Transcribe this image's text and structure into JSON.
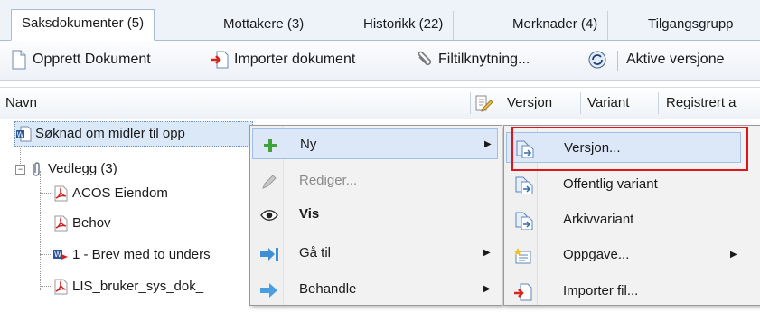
{
  "tabs": [
    {
      "label": "Saksdokumenter (5)",
      "active": true
    },
    {
      "label": "Mottakere (3)"
    },
    {
      "label": "Historikk (22)"
    },
    {
      "label": "Merknader (4)"
    },
    {
      "label": "Tilgangsgrupp"
    }
  ],
  "toolbar": {
    "create_label": "Opprett Dokument",
    "import_label": "Importer dokument",
    "link_label": "Filtilknytning...",
    "active_label": "Aktive versjone"
  },
  "columns": {
    "name": "Navn",
    "version": "Versjon",
    "variant": "Variant",
    "registered": "Registrert a"
  },
  "tree": {
    "main_doc": "Søknad om midler til opp",
    "attachments": "Vedlegg (3)",
    "items": [
      "ACOS Eiendom",
      "Behov",
      "1 - Brev med to unders",
      "LIS_bruker_sys_dok_"
    ]
  },
  "context_menu": {
    "items": [
      {
        "label": "Ny",
        "submenu": true,
        "highlighted": true,
        "icon": "plus-icon"
      },
      {
        "label": "Rediger...",
        "disabled": true,
        "icon": "pencil-icon"
      },
      {
        "label": "Vis",
        "bold": true,
        "icon": "eye-icon"
      },
      {
        "label": "Gå til",
        "submenu": true,
        "icon": "arrow-right-icon"
      },
      {
        "label": "Behandle",
        "submenu": true,
        "icon": "arrow-process-icon"
      }
    ]
  },
  "submenu": {
    "items": [
      {
        "label": "Versjon...",
        "highlighted": true,
        "icon": "document-version-icon"
      },
      {
        "label": "Offentlig variant",
        "icon": "document-variant-icon"
      },
      {
        "label": "Arkivvariant",
        "icon": "document-archive-icon"
      },
      {
        "label": "Oppgave...",
        "submenu": true,
        "icon": "task-icon"
      },
      {
        "label": "Importer fil...",
        "icon": "import-file-icon"
      }
    ]
  },
  "colors": {
    "highlight": "#dce8f7",
    "redbox": "#e0151b"
  }
}
